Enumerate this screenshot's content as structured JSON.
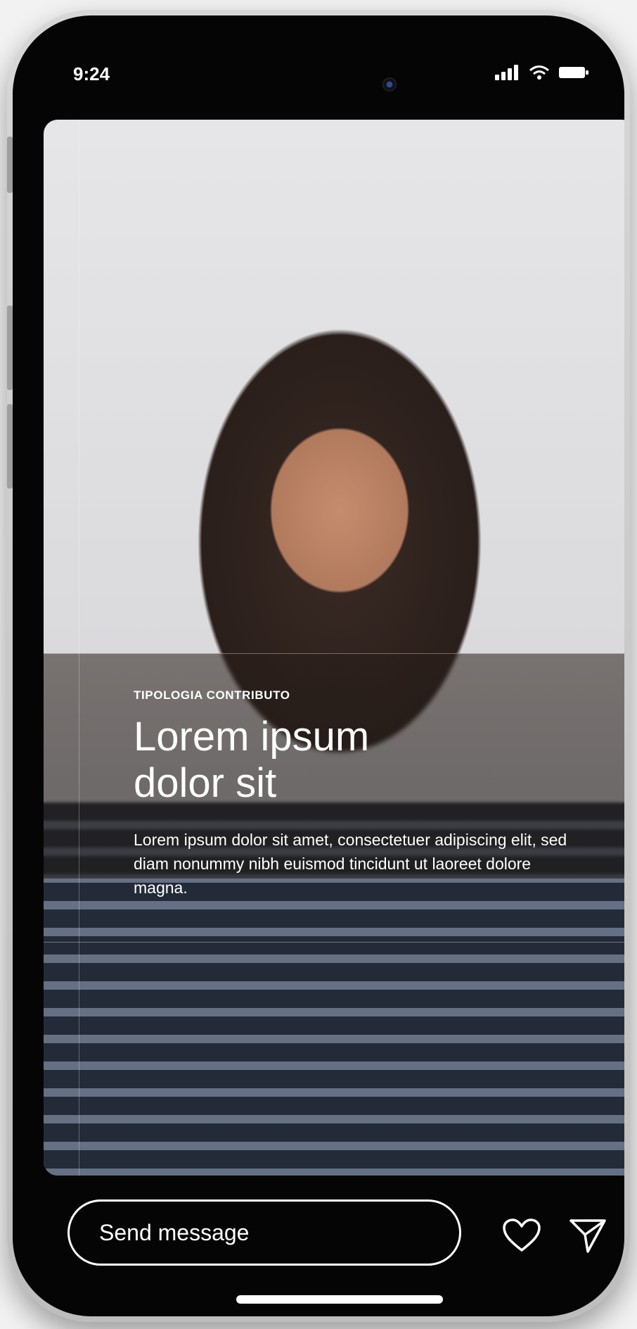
{
  "status_bar": {
    "time": "9:24"
  },
  "story": {
    "kicker": "TIPOLOGIA CONTRIBUTO",
    "title_line1": "Lorem ipsum",
    "title_line2": "dolor sit",
    "body": "Lorem ipsum dolor sit amet, consectetuer adipiscing elit, sed diam nonummy nibh euismod tincidunt ut laoreet dolore magna."
  },
  "composer": {
    "placeholder": "Send message"
  },
  "icons": {
    "signal": "signal-icon",
    "wifi": "wifi-icon",
    "battery": "battery-icon",
    "like": "heart-icon",
    "send": "send-icon"
  },
  "colors": {
    "frame": "#050505",
    "text": "#ffffff"
  }
}
